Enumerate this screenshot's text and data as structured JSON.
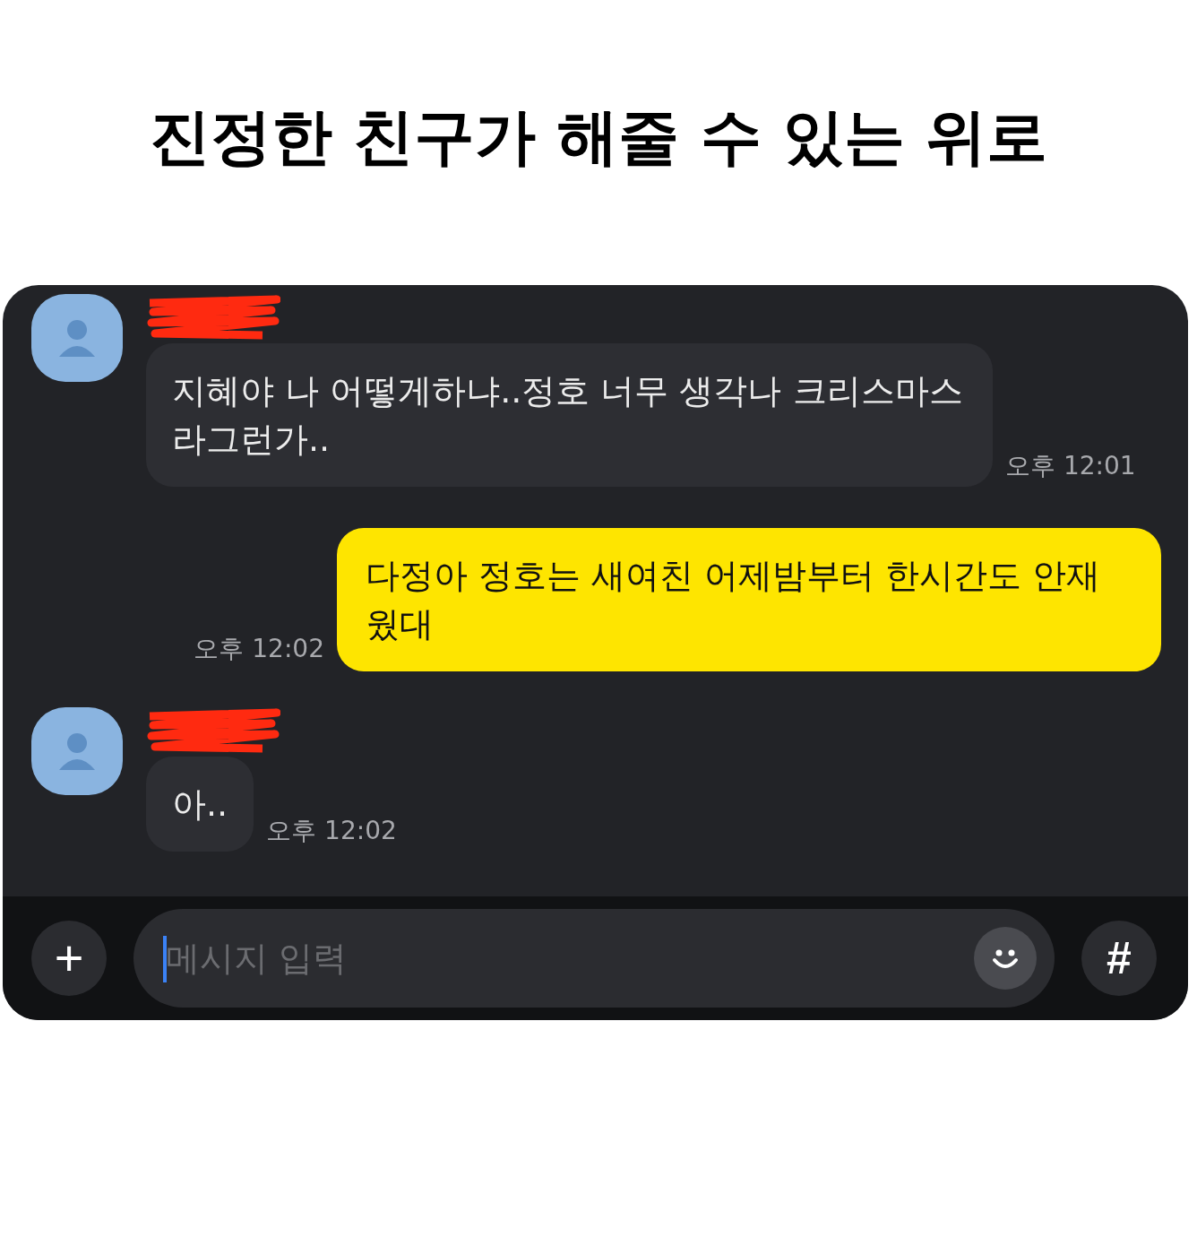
{
  "title": "진정한 친구가 해줄 수 있는 위로",
  "messages": [
    {
      "kind": "received",
      "text": "지혜야 나 어떻게하냐..정호 너무 생각나 크리스마스라그런가..",
      "time": "오후 12:01"
    },
    {
      "kind": "sent",
      "text": "다정아 정호는 새여친 어제밤부터 한시간도 안재웠대",
      "time": "오후 12:02"
    },
    {
      "kind": "received",
      "text": "아..",
      "time": "오후 12:02"
    }
  ],
  "composer": {
    "placeholder": "메시지 입력",
    "attach_button": "+",
    "tag_button": "#"
  }
}
